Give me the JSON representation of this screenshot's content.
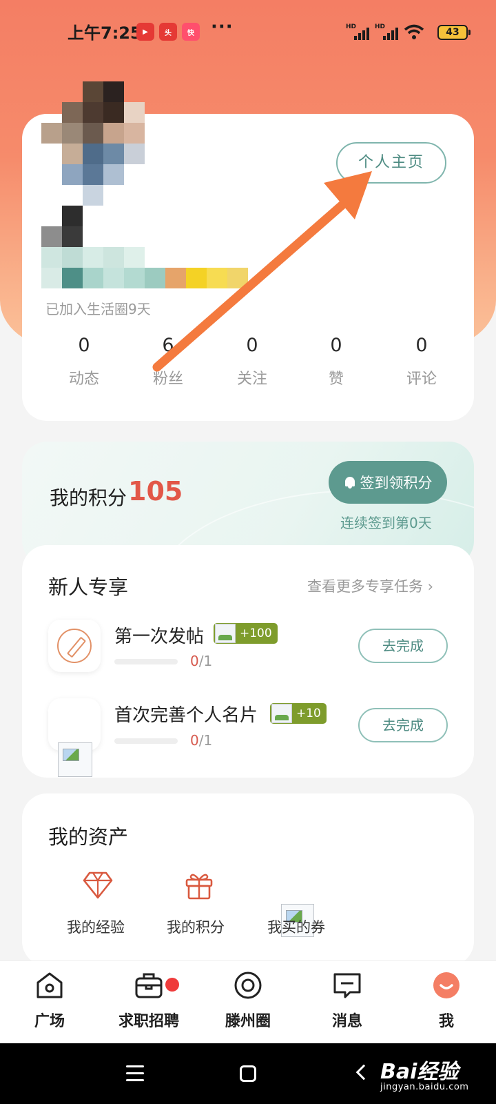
{
  "status_bar": {
    "time": "上午7:25",
    "battery": "43",
    "signal_labels": [
      "HD",
      "HD"
    ]
  },
  "profile": {
    "home_button": "个人主页",
    "joined_text": "已加入生活圈9天",
    "stats": [
      {
        "value": "0",
        "label": "动态"
      },
      {
        "value": "6",
        "label": "粉丝"
      },
      {
        "value": "0",
        "label": "关注"
      },
      {
        "value": "0",
        "label": "赞"
      },
      {
        "value": "0",
        "label": "评论"
      }
    ]
  },
  "points": {
    "label": "我的积分",
    "value": "105",
    "sign_button": "签到领积分",
    "streak": "连续签到第0天"
  },
  "newbie": {
    "title": "新人专享",
    "more_link": "查看更多专享任务 ›",
    "tasks": [
      {
        "title": "第一次发帖",
        "reward": "+100",
        "done": "0",
        "total": "/1",
        "progress": 0,
        "button": "去完成"
      },
      {
        "title": "首次完善个人名片",
        "reward": "+10",
        "done": "0",
        "total": "/1",
        "progress": 0,
        "button": "去完成"
      }
    ]
  },
  "assets": {
    "title": "我的资产",
    "items": [
      {
        "label": "我的经验",
        "icon": "diamond-icon"
      },
      {
        "label": "我的积分",
        "icon": "gift-icon"
      },
      {
        "label": "我买的券",
        "icon": "broken-image-icon"
      }
    ]
  },
  "tabbar": {
    "tabs": [
      {
        "label": "广场",
        "icon": "home-icon"
      },
      {
        "label": "求职招聘",
        "icon": "briefcase-icon"
      },
      {
        "label": "滕州圈",
        "icon": "circle-target-icon"
      },
      {
        "label": "消息",
        "icon": "message-icon"
      },
      {
        "label": "我",
        "icon": "profile-icon"
      }
    ]
  },
  "watermark": {
    "brand": "Bai经验",
    "url": "jingyan.baidu.com"
  },
  "colors": {
    "accent": "#f47e64",
    "teal": "#5d9a8f",
    "points_red": "#e25748",
    "arrow": "#f47a3e"
  }
}
